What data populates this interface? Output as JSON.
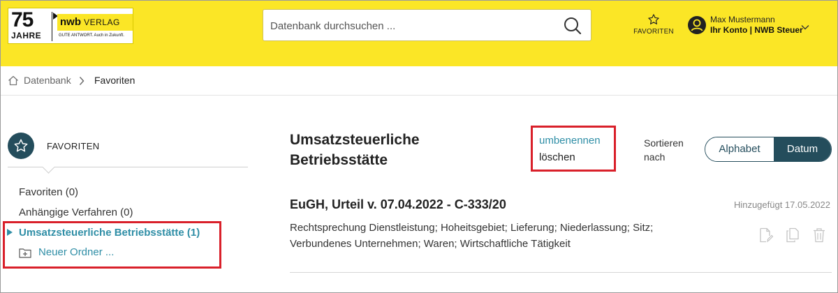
{
  "logo": {
    "anniversary": "75",
    "years": "JAHRE",
    "brand_bold": "nwb",
    "brand_rest": "VERLAG",
    "claim": "GUTE ANTWORT. Auch in Zukunft."
  },
  "header": {
    "search_placeholder": "Datenbank durchsuchen ...",
    "favorites_label": "FAVORITEN",
    "account_name": "Max Mustermann",
    "account_line": "Ihr Konto | NWB Steuer",
    "bg_color": "#fbe626"
  },
  "breadcrumb": {
    "items": [
      "Datenbank",
      "Favoriten"
    ]
  },
  "sidebar": {
    "title": "FAVORITEN",
    "items": [
      {
        "label": "Favoriten (0)"
      },
      {
        "label": "Anhängige Verfahren (0)"
      },
      {
        "label": "Umsatzsteuerliche Betriebsstätte (1)"
      }
    ],
    "new_folder": "Neuer Ordner ...",
    "accent_color": "#2f8ea6",
    "highlight_color": "#d9202a"
  },
  "main": {
    "folder_title": "Umsatzsteuerliche Betriebsstätte",
    "actions": {
      "rename": "umbenennen",
      "delete": "löschen"
    },
    "sort": {
      "label": "Sortieren nach",
      "options": [
        "Alphabet",
        "Datum"
      ],
      "selected": "Datum"
    },
    "results": [
      {
        "title": "EuGH, Urteil v. 07.04.2022 - C-333/20",
        "added": "Hinzugefügt 17.05.2022",
        "description": "Rechtsprechung Dienstleistung; Hoheitsgebiet; Lieferung; Niederlassung; Sitz; Verbundenes Unternehmen; Waren; Wirtschaftliche Tätigkeit",
        "icons": [
          "document-edit-icon",
          "copy-icon",
          "trash-icon"
        ]
      }
    ],
    "dark_color": "#244d5c"
  }
}
